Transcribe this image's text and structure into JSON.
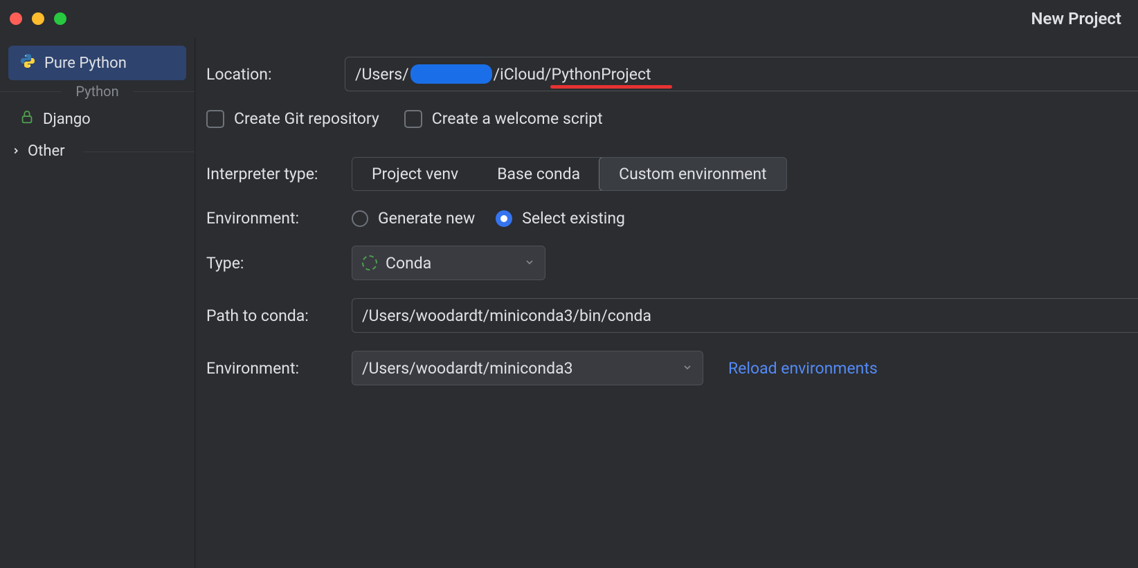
{
  "window": {
    "title": "New Project"
  },
  "sidebar": {
    "section_label": "Python",
    "items": [
      {
        "label": "Pure Python",
        "selected": true
      },
      {
        "label": "Django",
        "selected": false
      }
    ],
    "other_label": "Other"
  },
  "form": {
    "location_label": "Location:",
    "location_prefix": "/Users/",
    "location_suffix": "/iCloud/PythonProject",
    "git_checkbox_label": "Create Git repository",
    "welcome_checkbox_label": "Create a welcome script",
    "interpreter_type_label": "Interpreter type:",
    "interpreter_options": [
      "Project venv",
      "Base conda",
      "Custom environment"
    ],
    "interpreter_selected": "Custom environment",
    "environment_label": "Environment:",
    "env_radio_generate": "Generate new",
    "env_radio_existing": "Select existing",
    "type_label": "Type:",
    "type_value": "Conda",
    "conda_path_label": "Path to conda:",
    "conda_path_value": "/Users/woodardt/miniconda3/bin/conda",
    "environment2_label": "Environment:",
    "environment2_value": "/Users/woodardt/miniconda3",
    "reload_link": "Reload environments"
  }
}
